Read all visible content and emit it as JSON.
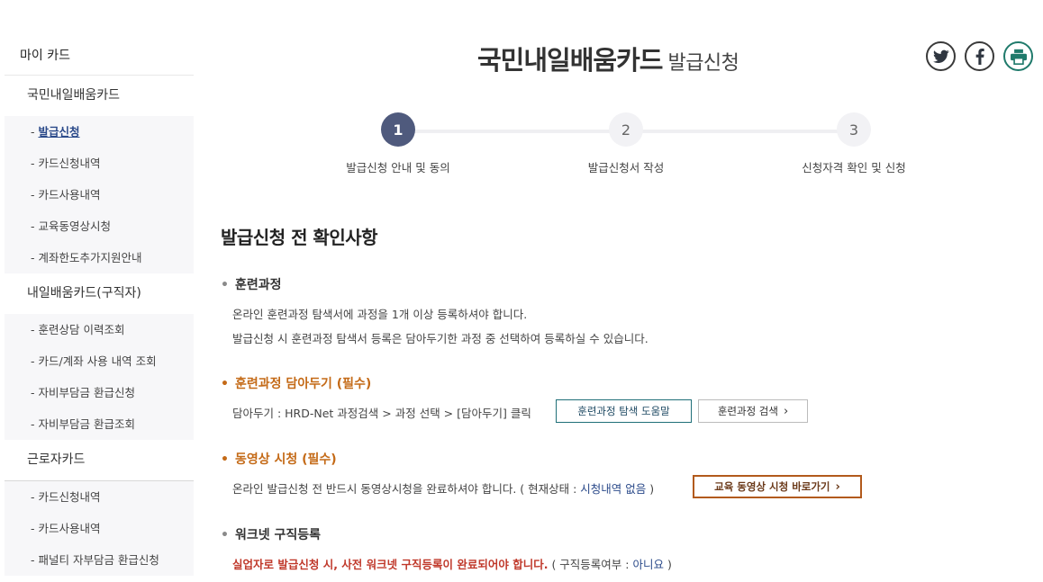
{
  "sidebar": {
    "title": "마이 카드",
    "groups": [
      {
        "label": "국민내일배움카드",
        "items": [
          "발급신청",
          "카드신청내역",
          "카드사용내역",
          "교육동영상시청",
          "계좌한도추가지원안내"
        ]
      },
      {
        "label": "내일배움카드(구직자)",
        "items": [
          "훈련상담 이력조회",
          "카드/계좌 사용 내역 조회",
          "자비부담금 환급신청",
          "자비부담금 환급조회"
        ]
      },
      {
        "label": "근로자카드",
        "items": [
          "카드신청내역",
          "카드사용내역",
          "패널티 자부담금 환급신청"
        ]
      }
    ],
    "item_prefix": "- "
  },
  "header": {
    "title": "국민내일배움카드",
    "subtitle": "발급신청"
  },
  "share": {
    "icons": [
      "twitter-icon",
      "facebook-icon",
      "print-icon"
    ],
    "colors": {
      "twitter": "#3a3a3a",
      "facebook": "#3a3a3a",
      "print": "#1f7a6b"
    }
  },
  "steps": [
    {
      "num": "1",
      "label": "발급신청 안내 및 동의"
    },
    {
      "num": "2",
      "label": "발급신청서 작성"
    },
    {
      "num": "3",
      "label": "신청자격 확인 및 신청"
    }
  ],
  "main": {
    "section_title": "발급신청 전 확인사항",
    "bullet": "•",
    "s1": {
      "title": "훈련과정",
      "line1": "온라인 훈련과정 탐색서에 과정을 1개 이상 등록하셔야 합니다.",
      "line2": "발급신청 시 훈련과정 탐색서 등록은 담아두기한 과정 중 선택하여 등록하실 수 있습니다."
    },
    "s2": {
      "title": "훈련과정 담아두기 (필수)",
      "line1": "담아두기 : HRD-Net 과정검색 > 과정 선택 > [담아두기] 클릭",
      "btn_help": "훈련과정 탐색 도움말",
      "btn_search": "훈련과정 검색"
    },
    "s3": {
      "title": "동영상 시청 (필수)",
      "line1_pre": "온라인 발급신청 전 반드시 동영상시청을 완료하셔야 합니다. ( 현재상태 : ",
      "status": "시청내역 없음",
      "line1_post": " )",
      "btn_video": "교육 동영상 시청 바로가기"
    },
    "s4": {
      "title": "워크넷 구직등록",
      "warning": "실업자로 발급신청 시, 사전 워크넷 구직등록이 완료되어야 합니다.",
      "reg_pre": " ( 구직등록여부 : ",
      "reg_value": "아니요",
      "reg_post": " )"
    }
  },
  "colors": {
    "step_active": "#4f5a7d",
    "accent_orange": "#c46a17",
    "link_blue": "#2b4a8a",
    "btn_teal": "#1f6f78",
    "btn_brown": "#b25a1c"
  }
}
